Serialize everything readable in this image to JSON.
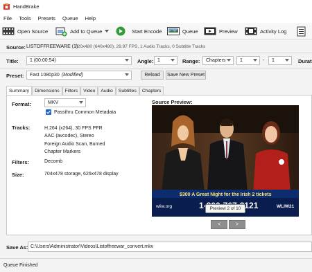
{
  "window": {
    "title": "HandBrake"
  },
  "menu": [
    "File",
    "Tools",
    "Presets",
    "Queue",
    "Help"
  ],
  "toolbar": {
    "open_source": "Open Source",
    "add_to_queue": "Add to Queue",
    "start_encode": "Start Encode",
    "queue": "Queue",
    "preview": "Preview",
    "activity_log": "Activity Log"
  },
  "source": {
    "label": "Source:",
    "name": "LISTOFFREEWARE (1)",
    "info": "720x480 (640x480), 29.97 FPS, 1 Audio Tracks, 0 Subtitle Tracks"
  },
  "title_row": {
    "title_label": "Title:",
    "title_value": "1 (00:00:54)",
    "angle_label": "Angle:",
    "angle_value": "1",
    "range_label": "Range:",
    "range_type": "Chapters",
    "range_start": "1",
    "range_sep": "-",
    "range_end": "1",
    "duration_label": "Durati"
  },
  "preset": {
    "label": "Preset:",
    "value": "Fast 1080p30",
    "modified": "(Modified)",
    "reload": "Reload",
    "save_new": "Save New Preset"
  },
  "tabs": [
    "Summary",
    "Dimensions",
    "Filters",
    "Video",
    "Audio",
    "Subtitles",
    "Chapters"
  ],
  "summary": {
    "format_label": "Format:",
    "format_value": "MKV",
    "passthru": "Passthru Common Metadata",
    "tracks_label": "Tracks:",
    "tracks": [
      "H.264 (x264), 30 FPS PFR",
      "AAC (avcodec), Stereo",
      "Foreign Audio Scan, Burned",
      "Chapter Markers"
    ],
    "filters_label": "Filters:",
    "filters_value": "Decomb",
    "size_label": "Size:",
    "size_value": "704x478 storage, 626x478 display",
    "source_preview_label": "Source Preview:",
    "preview_counter": "Preview 2 of 10",
    "prev": "<",
    "next": ">",
    "ticker_text": "$300  A Great Night for the Irish  2 tickets",
    "phone_number": "1-800-767-2121",
    "station_left": "wliw.org",
    "station_right": "WLIW21"
  },
  "save_as": {
    "label": "Save As:",
    "path": "C:\\Users\\Administrator\\Videos\\Listoffreewar_convert.mkv"
  },
  "status": "Queue Finished",
  "colors": {
    "accent": "#1e66c8",
    "start_green": "#2f9b3a"
  }
}
